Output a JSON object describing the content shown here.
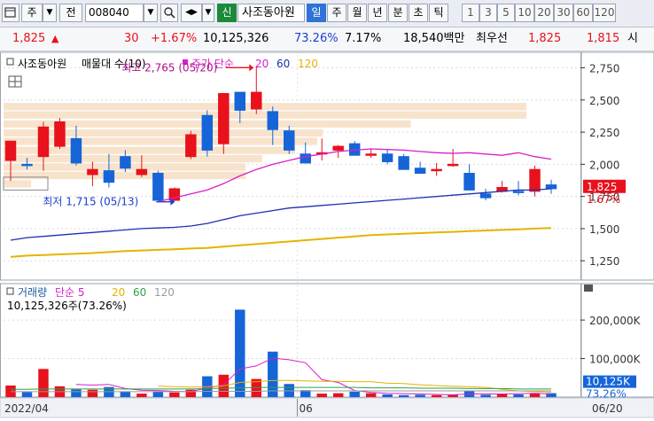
{
  "toolbar": {
    "market_label": "주",
    "market_dropdown": "▼",
    "prev_label": "전",
    "code_value": "008040",
    "code_dropdown": "▼",
    "nav_label": "◀▶",
    "nav_dropdown": "▼",
    "credit_label": "신",
    "stock_name": "사조동아원",
    "periods": [
      "일",
      "주",
      "월",
      "년",
      "분",
      "초",
      "틱"
    ],
    "selected_period": "일",
    "minute_presets": [
      "1",
      "3",
      "5",
      "10",
      "20",
      "30",
      "60",
      "120"
    ]
  },
  "quote": {
    "price": "1,825",
    "change_sign": "▲",
    "change": "30",
    "change_rate": "+1.67%",
    "volume": "10,125,326",
    "volume_ratio": "73.26%",
    "turnover": "7.17%",
    "amount": "18,540백만",
    "ask_label": "최우선",
    "ask": "1,825",
    "bid": "1,815",
    "more": "시"
  },
  "price_panel": {
    "legend_name": "사조동아원",
    "legend_vp": "매물대 수(10)",
    "legend_ma": "주가 단순",
    "ma_periods": [
      "20",
      "60",
      "120"
    ],
    "high_label": "최고 2,765 (05/20)",
    "low_label": "최저 1,715 (05/13)",
    "last_price_tag": "1,825",
    "last_rate_tag": "1.67%"
  },
  "volume_panel": {
    "legend_name": "거래량",
    "legend_ma": "단순 5",
    "ma_periods": [
      "20",
      "60",
      "120"
    ],
    "current_label": "10,125,326주(73.26%)",
    "last_volume_tag": "10,125K",
    "last_rate_tag": "73.26%"
  },
  "x_axis": {
    "labels": [
      "2022/04",
      "06",
      "06/20"
    ]
  },
  "colors": {
    "up": "#e8111c",
    "down": "#1565d8",
    "ma20": "#d81ec8",
    "ma60": "#1a31b4",
    "ma120": "#e6b300",
    "vol_ma5": "#d81ec8",
    "vol_ma20": "#e6b300",
    "vol_ma60": "#2fa04a",
    "vol_ma120": "#9a9a9a",
    "volume_profile": "#f7e3cc"
  },
  "chart_data": [
    {
      "type": "candlestick",
      "title": "사조동아원",
      "ylim": [
        1100,
        2850
      ],
      "y_ticks": [
        1250,
        1500,
        1750,
        2000,
        2250,
        2500,
        2750
      ],
      "y_tick_labels": [
        "1,250",
        "1,500",
        "1,750",
        "2,000",
        "2,250",
        "2,500",
        "2,750"
      ],
      "candles": [
        {
          "o": 2030,
          "h": 2180,
          "l": 1870,
          "c": 2180
        },
        {
          "o": 2000,
          "h": 2050,
          "l": 1960,
          "c": 1990
        },
        {
          "o": 2060,
          "h": 2330,
          "l": 1950,
          "c": 2290
        },
        {
          "o": 2140,
          "h": 2360,
          "l": 2120,
          "c": 2330
        },
        {
          "o": 2200,
          "h": 2300,
          "l": 1990,
          "c": 2010
        },
        {
          "o": 1920,
          "h": 2020,
          "l": 1830,
          "c": 1960
        },
        {
          "o": 1950,
          "h": 2080,
          "l": 1820,
          "c": 1860
        },
        {
          "o": 2060,
          "h": 2110,
          "l": 1940,
          "c": 1970
        },
        {
          "o": 1920,
          "h": 2070,
          "l": 1900,
          "c": 1960
        },
        {
          "o": 1930,
          "h": 1950,
          "l": 1715,
          "c": 1720
        },
        {
          "o": 1720,
          "h": 1820,
          "l": 1715,
          "c": 1810
        },
        {
          "o": 2060,
          "h": 2260,
          "l": 2040,
          "c": 2230
        },
        {
          "o": 2380,
          "h": 2420,
          "l": 2060,
          "c": 2110
        },
        {
          "o": 2160,
          "h": 2545,
          "l": 2080,
          "c": 2550
        },
        {
          "o": 2560,
          "h": 2520,
          "l": 2320,
          "c": 2420
        },
        {
          "o": 2430,
          "h": 2765,
          "l": 2390,
          "c": 2560
        },
        {
          "o": 2410,
          "h": 2450,
          "l": 2150,
          "c": 2270
        },
        {
          "o": 2260,
          "h": 2300,
          "l": 2080,
          "c": 2110
        },
        {
          "o": 2080,
          "h": 2170,
          "l": 2020,
          "c": 2010
        },
        {
          "o": 2080,
          "h": 2200,
          "l": 2030,
          "c": 2090
        },
        {
          "o": 2110,
          "h": 2150,
          "l": 2050,
          "c": 2140
        },
        {
          "o": 2160,
          "h": 2180,
          "l": 2080,
          "c": 2070
        },
        {
          "o": 2070,
          "h": 2120,
          "l": 2050,
          "c": 2080
        },
        {
          "o": 2080,
          "h": 2110,
          "l": 2000,
          "c": 2020
        },
        {
          "o": 2060,
          "h": 2080,
          "l": 2000,
          "c": 1960
        },
        {
          "o": 1970,
          "h": 2020,
          "l": 1950,
          "c": 1930
        },
        {
          "o": 1960,
          "h": 2010,
          "l": 1910,
          "c": 1960
        },
        {
          "o": 1990,
          "h": 2120,
          "l": 1980,
          "c": 2000
        },
        {
          "o": 1930,
          "h": 2000,
          "l": 1810,
          "c": 1800
        },
        {
          "o": 1770,
          "h": 1810,
          "l": 1720,
          "c": 1740
        },
        {
          "o": 1790,
          "h": 1870,
          "l": 1780,
          "c": 1820
        },
        {
          "o": 1790,
          "h": 1870,
          "l": 1760,
          "c": 1780
        },
        {
          "o": 1790,
          "h": 1990,
          "l": 1750,
          "c": 1960
        },
        {
          "o": 1840,
          "h": 1880,
          "l": 1770,
          "c": 1810
        }
      ],
      "series": [
        {
          "name": "20",
          "values": [
            null,
            null,
            null,
            null,
            null,
            null,
            null,
            null,
            null,
            1710,
            1740,
            1770,
            1800,
            1850,
            1910,
            1960,
            2000,
            2030,
            2060,
            2080,
            2100,
            2110,
            2120,
            2115,
            2110,
            2100,
            2090,
            2085,
            2090,
            2080,
            2070,
            2090,
            2060,
            2040
          ]
        },
        {
          "name": "60",
          "values": [
            1410,
            1430,
            1440,
            1450,
            1460,
            1470,
            1480,
            1490,
            1500,
            1505,
            1510,
            1520,
            1540,
            1570,
            1600,
            1620,
            1640,
            1660,
            1670,
            1680,
            1690,
            1700,
            1710,
            1720,
            1730,
            1740,
            1750,
            1760,
            1770,
            1780,
            1790,
            1800,
            1800,
            1810
          ]
        },
        {
          "name": "120",
          "values": [
            1280,
            1290,
            1295,
            1300,
            1305,
            1310,
            1318,
            1325,
            1330,
            1335,
            1340,
            1345,
            1350,
            1360,
            1370,
            1380,
            1390,
            1400,
            1410,
            1420,
            1430,
            1440,
            1450,
            1455,
            1460,
            1465,
            1470,
            1475,
            1480,
            1485,
            1490,
            1495,
            1500,
            1505
          ]
        }
      ],
      "volume_profile": [
        {
          "price": 2445,
          "weight": 0.95
        },
        {
          "price": 2380,
          "weight": 0.95
        },
        {
          "price": 2310,
          "weight": 0.74
        },
        {
          "price": 2240,
          "weight": 0.58
        },
        {
          "price": 2175,
          "weight": 0.57
        },
        {
          "price": 2105,
          "weight": 0.53
        },
        {
          "price": 2040,
          "weight": 0.47
        },
        {
          "price": 1975,
          "weight": 0.44
        },
        {
          "price": 1910,
          "weight": 0.44
        },
        {
          "price": 1845,
          "weight": 0.05
        }
      ]
    },
    {
      "type": "bar",
      "title": "거래량",
      "ylim": [
        0,
        290000
      ],
      "y_ticks": [
        100000,
        200000
      ],
      "y_tick_labels": [
        "100,000K",
        "200,000K"
      ],
      "volumes": [
        30000,
        13000,
        73000,
        28000,
        20000,
        19000,
        26000,
        14000,
        9000,
        15000,
        12000,
        19000,
        54000,
        58000,
        227000,
        47000,
        118000,
        34000,
        18000,
        9000,
        10000,
        14000,
        10000,
        7000,
        5000,
        6000,
        5000,
        6000,
        16000,
        6000,
        9000,
        7000,
        10000,
        10125
      ],
      "series": [
        {
          "name": "5",
          "values": [
            null,
            null,
            null,
            null,
            33000,
            31000,
            33000,
            22000,
            18000,
            17000,
            15000,
            14000,
            24000,
            32000,
            73000,
            81000,
            101000,
            97000,
            89000,
            45000,
            38000,
            17000,
            12000,
            10000,
            9000,
            8000,
            7000,
            6000,
            8000,
            8000,
            8000,
            9000,
            10000,
            8000
          ]
        },
        {
          "name": "20",
          "values": [
            null,
            null,
            null,
            null,
            null,
            null,
            null,
            null,
            null,
            28000,
            27000,
            26000,
            27000,
            29000,
            38000,
            40000,
            43000,
            43000,
            42000,
            41000,
            41000,
            40000,
            40000,
            36000,
            35000,
            32000,
            30000,
            28000,
            27000,
            25000,
            20000,
            16000,
            14000,
            13000
          ]
        },
        {
          "name": "60",
          "values": [
            20000,
            20000,
            21000,
            21000,
            21000,
            21000,
            21000,
            21000,
            21000,
            21000,
            21000,
            21000,
            22000,
            23000,
            24000,
            25000,
            25000,
            25000,
            25000,
            25000,
            25000,
            25000,
            24000,
            24000,
            24000,
            23000,
            23000,
            23000,
            22000,
            22000,
            22000,
            21000,
            21000,
            21000
          ]
        },
        {
          "name": "120",
          "values": [
            14000,
            14000,
            14000,
            14000,
            14000,
            14000,
            14000,
            14000,
            14000,
            14000,
            14000,
            14000,
            15000,
            15000,
            15000,
            15000,
            16000,
            16000,
            16000,
            16000,
            16000,
            16000,
            16000,
            16000,
            16000,
            16000,
            16000,
            16000,
            16000,
            16000,
            16000,
            16000,
            16000,
            16000
          ]
        }
      ]
    }
  ]
}
